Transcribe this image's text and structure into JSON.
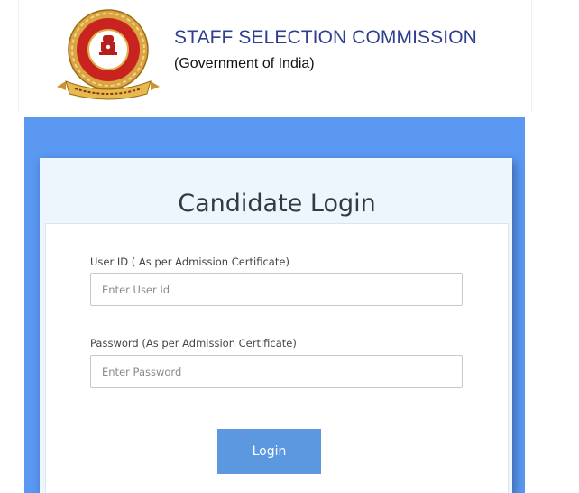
{
  "header": {
    "org_name": "STAFF SELECTION COMMISSION",
    "org_subtitle": "(Government of India)",
    "emblem_icon": "ssc-emblem-icon"
  },
  "login": {
    "title": "Candidate Login",
    "user_id_label": "User ID ( As per Admission Certificate)",
    "user_id_placeholder": "Enter User Id",
    "user_id_value": "",
    "password_label": "Password (As per Admission Certificate)",
    "password_placeholder": "Enter Password",
    "password_value": "",
    "submit_label": "Login"
  },
  "colors": {
    "band": "#5b98f2",
    "card_background": "#eef6fd",
    "button": "#5b98e0",
    "org_name": "#2e3f8f"
  }
}
